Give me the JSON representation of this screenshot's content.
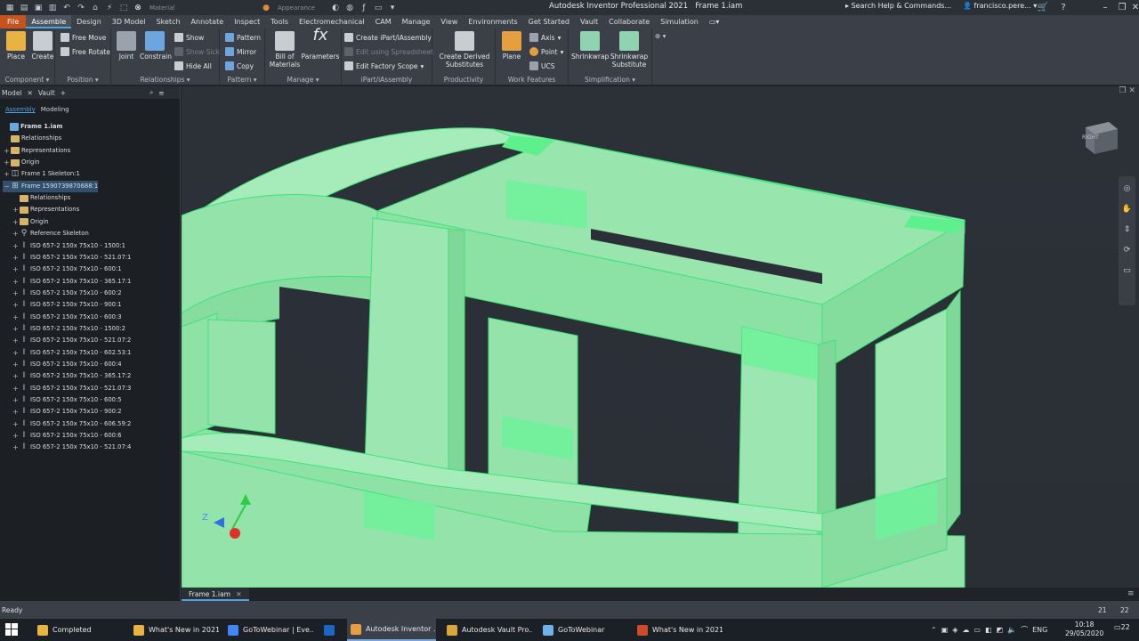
{
  "app": {
    "title": "Autodesk Inventor Professional 2021",
    "document_title": "Frame 1.iam",
    "help_search": "Search Help & Commands...",
    "user": "francisco.pere...",
    "material_dropdown": "Material",
    "appearance_dropdown": "Appearance"
  },
  "menu_tabs": [
    {
      "label": "File"
    },
    {
      "label": "Assemble"
    },
    {
      "label": "Design"
    },
    {
      "label": "3D Model"
    },
    {
      "label": "Sketch"
    },
    {
      "label": "Annotate"
    },
    {
      "label": "Inspect"
    },
    {
      "label": "Tools"
    },
    {
      "label": "Electromechanical"
    },
    {
      "label": "CAM"
    },
    {
      "label": "Manage"
    },
    {
      "label": "View"
    },
    {
      "label": "Environments"
    },
    {
      "label": "Get Started"
    },
    {
      "label": "Vault"
    },
    {
      "label": "Collaborate"
    },
    {
      "label": "Simulation"
    }
  ],
  "ribbon": {
    "component": {
      "name": "Component",
      "place": "Place",
      "create": "Create"
    },
    "position": {
      "name": "Position",
      "free_move": "Free Move",
      "free_rotate": "Free Rotate"
    },
    "relationships": {
      "name": "Relationships",
      "joint": "Joint",
      "constrain": "Constrain",
      "show": "Show",
      "show_sick": "Show Sick",
      "hide_all": "Hide All"
    },
    "pattern": {
      "name": "Pattern",
      "pattern": "Pattern",
      "mirror": "Mirror",
      "copy": "Copy"
    },
    "manage": {
      "name": "Manage",
      "bom": "Bill of Materials",
      "parameters": "Parameters"
    },
    "ipart": {
      "name": "iPart/iAssembly",
      "create": "Create iPart/iAssembly",
      "edit_sheet": "Edit using Spreadsheet",
      "edit_scope": "Edit Factory Scope"
    },
    "productivity": {
      "name": "Productivity",
      "derived": "Create Derived Substitutes"
    },
    "work_features": {
      "name": "Work Features",
      "plane": "Plane",
      "axis": "Axis",
      "point": "Point",
      "ucs": "UCS"
    },
    "simplification": {
      "name": "Simplification",
      "shrinkwrap": "Shrinkwrap",
      "shrinkwrap_sub": "Shrinkwrap Substitute"
    }
  },
  "browser": {
    "tabs": [
      "Model",
      "Vault"
    ],
    "subtabs": {
      "assembly": "Assembly",
      "modeling": "Modeling"
    },
    "tree": [
      {
        "label": "Frame 1.iam",
        "level": 0,
        "icon": "assembly",
        "expander": ""
      },
      {
        "label": "Relationships",
        "level": 1,
        "icon": "folder",
        "expander": ""
      },
      {
        "label": "Representations",
        "level": 1,
        "icon": "folder",
        "expander": "+"
      },
      {
        "label": "Origin",
        "level": 1,
        "icon": "folder",
        "expander": "+"
      },
      {
        "label": "Frame 1 Skeleton:1",
        "level": 1,
        "icon": "part",
        "expander": "+"
      },
      {
        "label": "Frame 1590739870688:1",
        "level": 1,
        "icon": "frame",
        "expander": "−"
      },
      {
        "label": "Relationships",
        "level": 2,
        "icon": "folder",
        "expander": ""
      },
      {
        "label": "Representations",
        "level": 2,
        "icon": "folder",
        "expander": "+"
      },
      {
        "label": "Origin",
        "level": 2,
        "icon": "folder",
        "expander": "+"
      },
      {
        "label": "Reference Skeleton",
        "level": 2,
        "icon": "skeleton",
        "expander": "+"
      },
      {
        "label": "ISO 657-2 150x 75x10 - 1500:1",
        "level": 2,
        "icon": "beam",
        "expander": "+"
      },
      {
        "label": "ISO 657-2 150x 75x10 - 521.07:1",
        "level": 2,
        "icon": "beam",
        "expander": "+"
      },
      {
        "label": "ISO 657-2 150x 75x10 - 600:1",
        "level": 2,
        "icon": "beam",
        "expander": "+"
      },
      {
        "label": "ISO 657-2 150x 75x10 - 365.17:1",
        "level": 2,
        "icon": "beam",
        "expander": "+"
      },
      {
        "label": "ISO 657-2 150x 75x10 - 600:2",
        "level": 2,
        "icon": "beam",
        "expander": "+"
      },
      {
        "label": "ISO 657-2 150x 75x10 - 900:1",
        "level": 2,
        "icon": "beam",
        "expander": "+"
      },
      {
        "label": "ISO 657-2 150x 75x10 - 600:3",
        "level": 2,
        "icon": "beam",
        "expander": "+"
      },
      {
        "label": "ISO 657-2 150x 75x10 - 1500:2",
        "level": 2,
        "icon": "beam",
        "expander": "+"
      },
      {
        "label": "ISO 657-2 150x 75x10 - 521.07:2",
        "level": 2,
        "icon": "beam",
        "expander": "+"
      },
      {
        "label": "ISO 657-2 150x 75x10 - 602.53:1",
        "level": 2,
        "icon": "beam",
        "expander": "+"
      },
      {
        "label": "ISO 657-2 150x 75x10 - 600:4",
        "level": 2,
        "icon": "beam",
        "expander": "+"
      },
      {
        "label": "ISO 657-2 150x 75x10 - 365.17:2",
        "level": 2,
        "icon": "beam",
        "expander": "+"
      },
      {
        "label": "ISO 657-2 150x 75x10 - 521.07:3",
        "level": 2,
        "icon": "beam",
        "expander": "+"
      },
      {
        "label": "ISO 657-2 150x 75x10 - 600:5",
        "level": 2,
        "icon": "beam",
        "expander": "+"
      },
      {
        "label": "ISO 657-2 150x 75x10 - 900:2",
        "level": 2,
        "icon": "beam",
        "expander": "+"
      },
      {
        "label": "ISO 657-2 150x 75x10 - 606.59:2",
        "level": 2,
        "icon": "beam",
        "expander": "+"
      },
      {
        "label": "ISO 657-2 150x 75x10 - 600:6",
        "level": 2,
        "icon": "beam",
        "expander": "+"
      },
      {
        "label": "ISO 657-2 150x 75x10 - 521.07:4",
        "level": 2,
        "icon": "beam",
        "expander": "+"
      }
    ]
  },
  "viewport": {
    "viewcube_label": "RIGHT",
    "triad_z": "Z",
    "model_color": "#8ee6a6",
    "edge_color": "#3fe37a"
  },
  "document_tabs": [
    "Frame 1.iam"
  ],
  "status": {
    "text": "Ready",
    "n1": "21",
    "n2": "22"
  },
  "taskbar": {
    "items": [
      {
        "label": "Completed",
        "icon": "folder-icon",
        "color": "#e8b341"
      },
      {
        "label": "What's New in 2021",
        "icon": "folder-icon",
        "color": "#e8b341"
      },
      {
        "label": "GoToWebinar | Eve...",
        "icon": "chrome-icon",
        "color": "#4285f4"
      },
      {
        "label": "",
        "icon": "outlook-icon",
        "color": "#1d66c4"
      },
      {
        "label": "Autodesk Inventor ...",
        "icon": "inventor-icon",
        "color": "#e59f3e"
      },
      {
        "label": "Autodesk Vault Pro...",
        "icon": "vault-icon",
        "color": "#d8a63a"
      },
      {
        "label": "GoToWebinar",
        "icon": "gotowebinar-icon",
        "color": "#6fb1e8"
      },
      {
        "label": "What's New in 2021...",
        "icon": "powerpoint-icon",
        "color": "#cf4a2a"
      }
    ],
    "language": "ENG",
    "time": "10:18",
    "date": "29/05/2020",
    "notifications": "22"
  }
}
